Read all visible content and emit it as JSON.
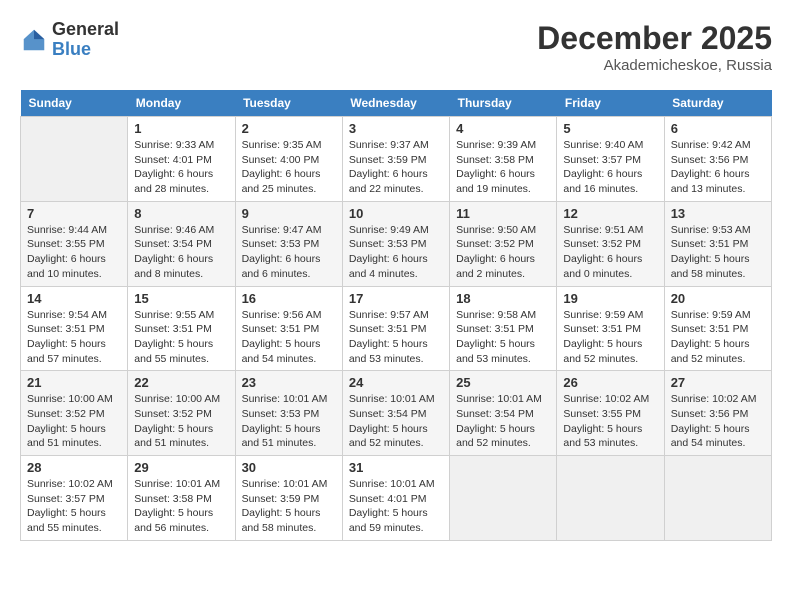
{
  "header": {
    "logo_general": "General",
    "logo_blue": "Blue",
    "month_year": "December 2025",
    "location": "Akademicheskoe, Russia"
  },
  "calendar": {
    "days_of_week": [
      "Sunday",
      "Monday",
      "Tuesday",
      "Wednesday",
      "Thursday",
      "Friday",
      "Saturday"
    ],
    "weeks": [
      [
        {
          "day": "",
          "info": ""
        },
        {
          "day": "1",
          "info": "Sunrise: 9:33 AM\nSunset: 4:01 PM\nDaylight: 6 hours\nand 28 minutes."
        },
        {
          "day": "2",
          "info": "Sunrise: 9:35 AM\nSunset: 4:00 PM\nDaylight: 6 hours\nand 25 minutes."
        },
        {
          "day": "3",
          "info": "Sunrise: 9:37 AM\nSunset: 3:59 PM\nDaylight: 6 hours\nand 22 minutes."
        },
        {
          "day": "4",
          "info": "Sunrise: 9:39 AM\nSunset: 3:58 PM\nDaylight: 6 hours\nand 19 minutes."
        },
        {
          "day": "5",
          "info": "Sunrise: 9:40 AM\nSunset: 3:57 PM\nDaylight: 6 hours\nand 16 minutes."
        },
        {
          "day": "6",
          "info": "Sunrise: 9:42 AM\nSunset: 3:56 PM\nDaylight: 6 hours\nand 13 minutes."
        }
      ],
      [
        {
          "day": "7",
          "info": "Sunrise: 9:44 AM\nSunset: 3:55 PM\nDaylight: 6 hours\nand 10 minutes."
        },
        {
          "day": "8",
          "info": "Sunrise: 9:46 AM\nSunset: 3:54 PM\nDaylight: 6 hours\nand 8 minutes."
        },
        {
          "day": "9",
          "info": "Sunrise: 9:47 AM\nSunset: 3:53 PM\nDaylight: 6 hours\nand 6 minutes."
        },
        {
          "day": "10",
          "info": "Sunrise: 9:49 AM\nSunset: 3:53 PM\nDaylight: 6 hours\nand 4 minutes."
        },
        {
          "day": "11",
          "info": "Sunrise: 9:50 AM\nSunset: 3:52 PM\nDaylight: 6 hours\nand 2 minutes."
        },
        {
          "day": "12",
          "info": "Sunrise: 9:51 AM\nSunset: 3:52 PM\nDaylight: 6 hours\nand 0 minutes."
        },
        {
          "day": "13",
          "info": "Sunrise: 9:53 AM\nSunset: 3:51 PM\nDaylight: 5 hours\nand 58 minutes."
        }
      ],
      [
        {
          "day": "14",
          "info": "Sunrise: 9:54 AM\nSunset: 3:51 PM\nDaylight: 5 hours\nand 57 minutes."
        },
        {
          "day": "15",
          "info": "Sunrise: 9:55 AM\nSunset: 3:51 PM\nDaylight: 5 hours\nand 55 minutes."
        },
        {
          "day": "16",
          "info": "Sunrise: 9:56 AM\nSunset: 3:51 PM\nDaylight: 5 hours\nand 54 minutes."
        },
        {
          "day": "17",
          "info": "Sunrise: 9:57 AM\nSunset: 3:51 PM\nDaylight: 5 hours\nand 53 minutes."
        },
        {
          "day": "18",
          "info": "Sunrise: 9:58 AM\nSunset: 3:51 PM\nDaylight: 5 hours\nand 53 minutes."
        },
        {
          "day": "19",
          "info": "Sunrise: 9:59 AM\nSunset: 3:51 PM\nDaylight: 5 hours\nand 52 minutes."
        },
        {
          "day": "20",
          "info": "Sunrise: 9:59 AM\nSunset: 3:51 PM\nDaylight: 5 hours\nand 52 minutes."
        }
      ],
      [
        {
          "day": "21",
          "info": "Sunrise: 10:00 AM\nSunset: 3:52 PM\nDaylight: 5 hours\nand 51 minutes."
        },
        {
          "day": "22",
          "info": "Sunrise: 10:00 AM\nSunset: 3:52 PM\nDaylight: 5 hours\nand 51 minutes."
        },
        {
          "day": "23",
          "info": "Sunrise: 10:01 AM\nSunset: 3:53 PM\nDaylight: 5 hours\nand 51 minutes."
        },
        {
          "day": "24",
          "info": "Sunrise: 10:01 AM\nSunset: 3:54 PM\nDaylight: 5 hours\nand 52 minutes."
        },
        {
          "day": "25",
          "info": "Sunrise: 10:01 AM\nSunset: 3:54 PM\nDaylight: 5 hours\nand 52 minutes."
        },
        {
          "day": "26",
          "info": "Sunrise: 10:02 AM\nSunset: 3:55 PM\nDaylight: 5 hours\nand 53 minutes."
        },
        {
          "day": "27",
          "info": "Sunrise: 10:02 AM\nSunset: 3:56 PM\nDaylight: 5 hours\nand 54 minutes."
        }
      ],
      [
        {
          "day": "28",
          "info": "Sunrise: 10:02 AM\nSunset: 3:57 PM\nDaylight: 5 hours\nand 55 minutes."
        },
        {
          "day": "29",
          "info": "Sunrise: 10:01 AM\nSunset: 3:58 PM\nDaylight: 5 hours\nand 56 minutes."
        },
        {
          "day": "30",
          "info": "Sunrise: 10:01 AM\nSunset: 3:59 PM\nDaylight: 5 hours\nand 58 minutes."
        },
        {
          "day": "31",
          "info": "Sunrise: 10:01 AM\nSunset: 4:01 PM\nDaylight: 5 hours\nand 59 minutes."
        },
        {
          "day": "",
          "info": ""
        },
        {
          "day": "",
          "info": ""
        },
        {
          "day": "",
          "info": ""
        }
      ]
    ]
  }
}
